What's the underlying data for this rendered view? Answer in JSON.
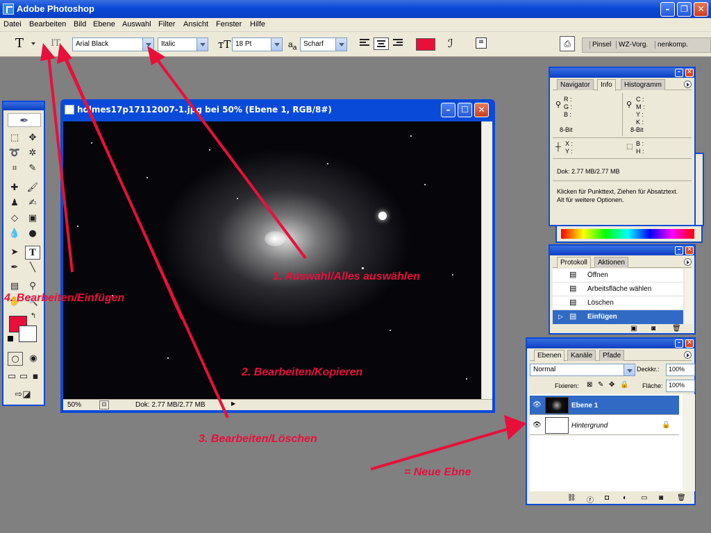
{
  "app": {
    "title": "Adobe Photoshop"
  },
  "menu": [
    "Datei",
    "Bearbeiten",
    "Bild",
    "Ebene",
    "Auswahl",
    "Filter",
    "Ansicht",
    "Fenster",
    "Hilfe"
  ],
  "options": {
    "font_family": "Arial Black",
    "font_style": "Italic",
    "font_size": "18 Pt",
    "aa_label": "a",
    "antialias": "Scharf",
    "text_color": "#e8103a",
    "palette_well": [
      "Pinsel",
      "WZ-Vorg.",
      "nenkomp."
    ]
  },
  "info_panel": {
    "tabs": [
      "Navigator",
      "Info",
      "Histogramm"
    ],
    "left_rgb": [
      "R :",
      "G :",
      "B :"
    ],
    "right_cmyk": [
      "C :",
      "M :",
      "Y :",
      "K :"
    ],
    "bit_left": "8-Bit",
    "bit_right": "8-Bit",
    "xy": [
      "X :",
      "Y :"
    ],
    "bh": [
      "B :",
      "H :"
    ],
    "doc": "Dok: 2.77 MB/2.77 MB",
    "hint": "Klicken für Punkttext, Ziehen für Absatztext. Alt für weitere Optionen."
  },
  "history_panel": {
    "tabs": [
      "Protokoll",
      "Aktionen"
    ],
    "items": [
      "Öffnen",
      "Arbeitsfläche wählen",
      "Löschen",
      "Einfügen"
    ]
  },
  "layers_panel": {
    "tabs": [
      "Ebenen",
      "Kanäle",
      "Pfade"
    ],
    "blend_mode": "Normal",
    "opacity_label": "Deckkr.:",
    "opacity": "100%",
    "lock_label": "Fixieren:",
    "fill_label": "Fläche:",
    "fill": "100%",
    "layers": [
      "Ebene 1",
      "Hintergrund"
    ]
  },
  "document": {
    "title": "holmes17p17112007-1.jpg bei 50% (Ebene 1, RGB/8#)",
    "zoom": "50%",
    "status": "Dok: 2.77 MB/2.77 MB"
  },
  "annotations": {
    "a1": "1. Auswahl/Alles auswählen",
    "a2": "2. Bearbeiten/Kopieren",
    "a3": "3. Bearbeiten/Löschen",
    "a4": "4. Bearbeiten/Einfügen",
    "a5": "= Neue Ebne"
  }
}
